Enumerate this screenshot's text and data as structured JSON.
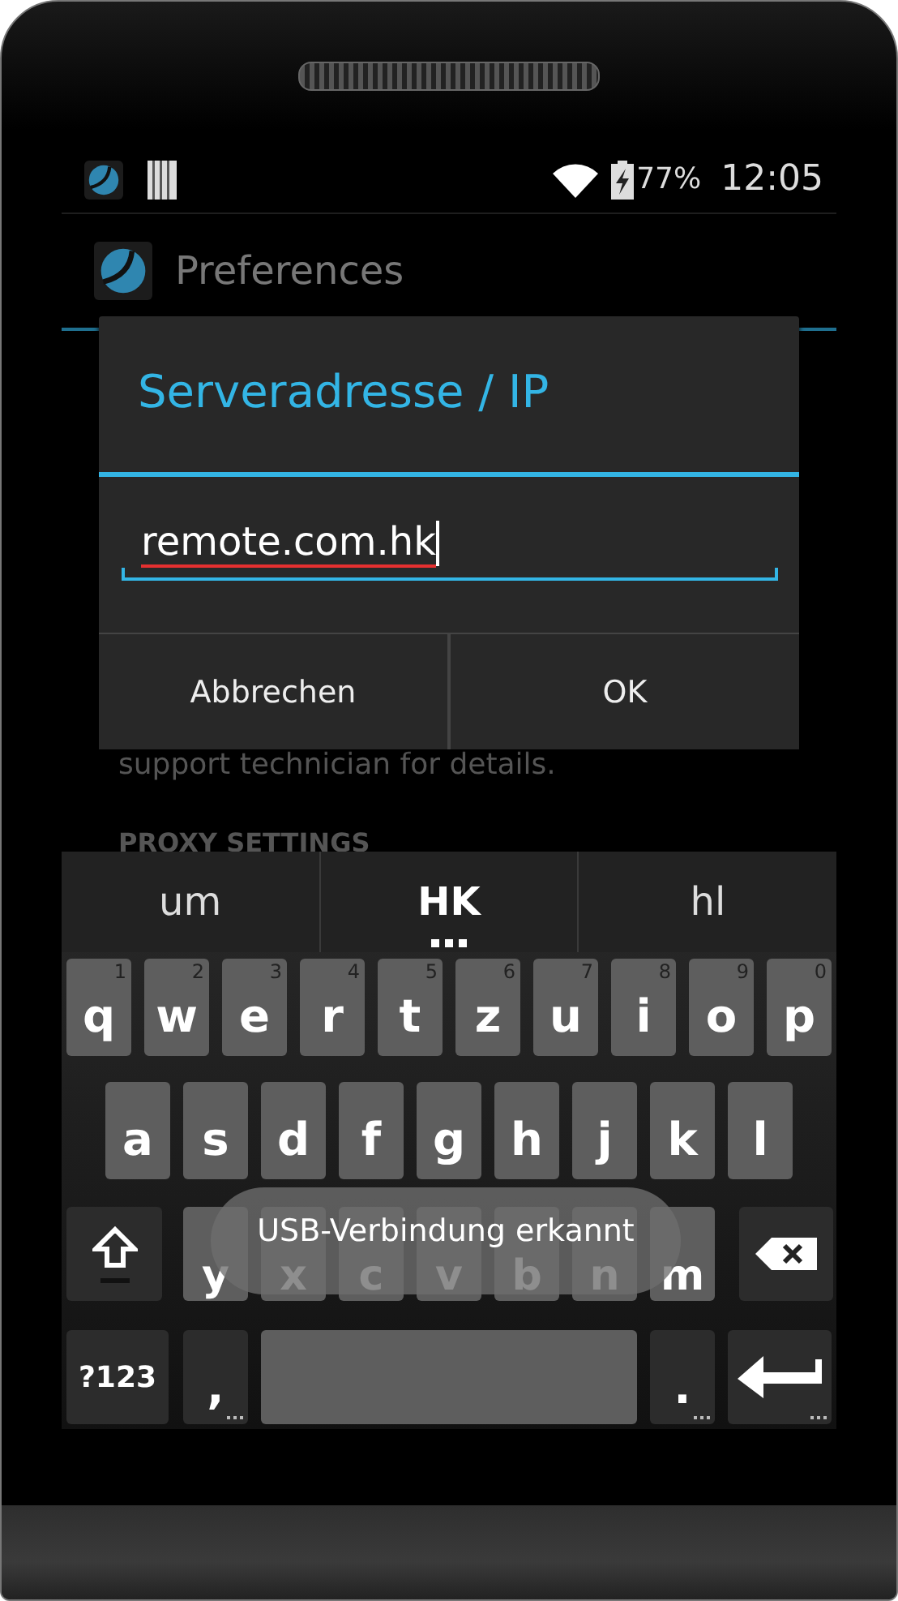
{
  "status_bar": {
    "battery": "77%",
    "time": "12:05"
  },
  "action_bar": {
    "title": "Preferences"
  },
  "background_text": [
    {
      "kind": "body",
      "text": "support technician for details."
    },
    {
      "kind": "header",
      "text": "PROXY SETTINGS"
    }
  ],
  "dialog": {
    "title": "Serveradresse / IP",
    "field": {
      "value": "remote.com.hk",
      "spelling_error": true
    },
    "buttons": [
      "Abbrechen",
      "OK"
    ]
  },
  "keyboard": {
    "suggestions": [
      {
        "text": "um",
        "selected": false
      },
      {
        "text": "HK",
        "selected": true
      },
      {
        "text": "hl",
        "selected": false
      }
    ],
    "rows": [
      {
        "keys": [
          {
            "kind": "letter",
            "label": "q",
            "hint": "1"
          },
          {
            "kind": "letter",
            "label": "w",
            "hint": "2"
          },
          {
            "kind": "letter",
            "label": "e",
            "hint": "3"
          },
          {
            "kind": "letter",
            "label": "r",
            "hint": "4"
          },
          {
            "kind": "letter",
            "label": "t",
            "hint": "5"
          },
          {
            "kind": "letter",
            "label": "z",
            "hint": "6"
          },
          {
            "kind": "letter",
            "label": "u",
            "hint": "7"
          },
          {
            "kind": "letter",
            "label": "i",
            "hint": "8"
          },
          {
            "kind": "letter",
            "label": "o",
            "hint": "9"
          },
          {
            "kind": "letter",
            "label": "p",
            "hint": "0"
          }
        ]
      },
      {
        "keys": [
          {
            "kind": "letter",
            "label": "a"
          },
          {
            "kind": "letter",
            "label": "s"
          },
          {
            "kind": "letter",
            "label": "d"
          },
          {
            "kind": "letter",
            "label": "f"
          },
          {
            "kind": "letter",
            "label": "g"
          },
          {
            "kind": "letter",
            "label": "h"
          },
          {
            "kind": "letter",
            "label": "j"
          },
          {
            "kind": "letter",
            "label": "k"
          },
          {
            "kind": "letter",
            "label": "l"
          }
        ]
      },
      {
        "keys": [
          {
            "kind": "shift"
          },
          {
            "kind": "letter",
            "label": "y"
          },
          {
            "kind": "letter",
            "label": "x"
          },
          {
            "kind": "letter",
            "label": "c"
          },
          {
            "kind": "letter",
            "label": "v"
          },
          {
            "kind": "letter",
            "label": "b"
          },
          {
            "kind": "letter",
            "label": "n"
          },
          {
            "kind": "letter",
            "label": "m"
          },
          {
            "kind": "backspace"
          }
        ]
      },
      {
        "keys": [
          {
            "kind": "symbols",
            "label": "?123"
          },
          {
            "kind": "punct",
            "label": ",",
            "more": true
          },
          {
            "kind": "space"
          },
          {
            "kind": "punct",
            "label": ".",
            "more": true
          },
          {
            "kind": "enter",
            "more": true
          }
        ]
      }
    ]
  },
  "toast": "USB-Verbindung erkannt"
}
